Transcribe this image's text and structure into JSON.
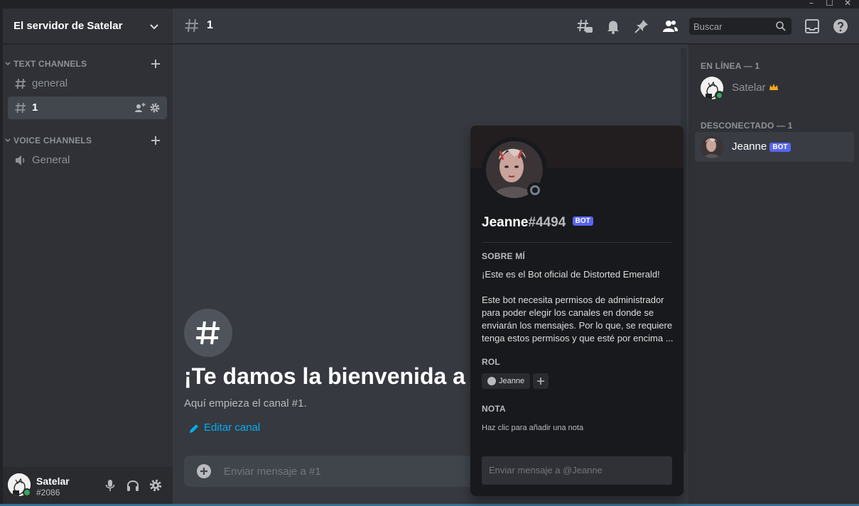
{
  "server": {
    "name": "El servidor de Satelar"
  },
  "categories": {
    "text": "TEXT CHANNELS",
    "voice": "VOICE CHANNELS"
  },
  "channels": [
    {
      "name": "general",
      "type": "text"
    },
    {
      "name": "1",
      "type": "text",
      "active": true
    },
    {
      "name": "General",
      "type": "voice"
    }
  ],
  "user": {
    "name": "Satelar",
    "tag": "#2086",
    "status": "online"
  },
  "header": {
    "channel": "1",
    "search_placeholder": "Buscar"
  },
  "welcome": {
    "title": "¡Te damos la bienvenida a",
    "subtitle": "Aquí empieza el canal #1.",
    "edit": "Editar canal"
  },
  "composer": {
    "placeholder": "Enviar mensaje a #1"
  },
  "members": {
    "online_label": "EN LÍNEA — 1",
    "offline_label": "DESCONECTADO — 1",
    "online": [
      {
        "name": "Satelar",
        "owner": true
      }
    ],
    "offline": [
      {
        "name": "Jeanne",
        "badge": "BOT"
      }
    ]
  },
  "profile": {
    "name": "Jeanne",
    "discriminator": "#4494",
    "badge": "BOT",
    "about_title": "SOBRE MÍ",
    "about_p1": "¡Este es el Bot oficial de Distorted Emerald!",
    "about_p2": "Este bot necesita permisos de administrador para poder elegir los canales en donde se enviarán los mensajes. Por lo que, se requiere tenga estos permisos y que esté por encima ...",
    "role_title": "ROL",
    "role": "Jeanne",
    "note_title": "NOTA",
    "note_placeholder": "Haz clic para añadir una nota",
    "dm_placeholder": "Enviar mensaje a @Jeanne"
  },
  "colors": {
    "blurple": "#5865f2",
    "online": "#3ba55d",
    "link": "#00aff4",
    "owner_crown": "#faa61a"
  }
}
